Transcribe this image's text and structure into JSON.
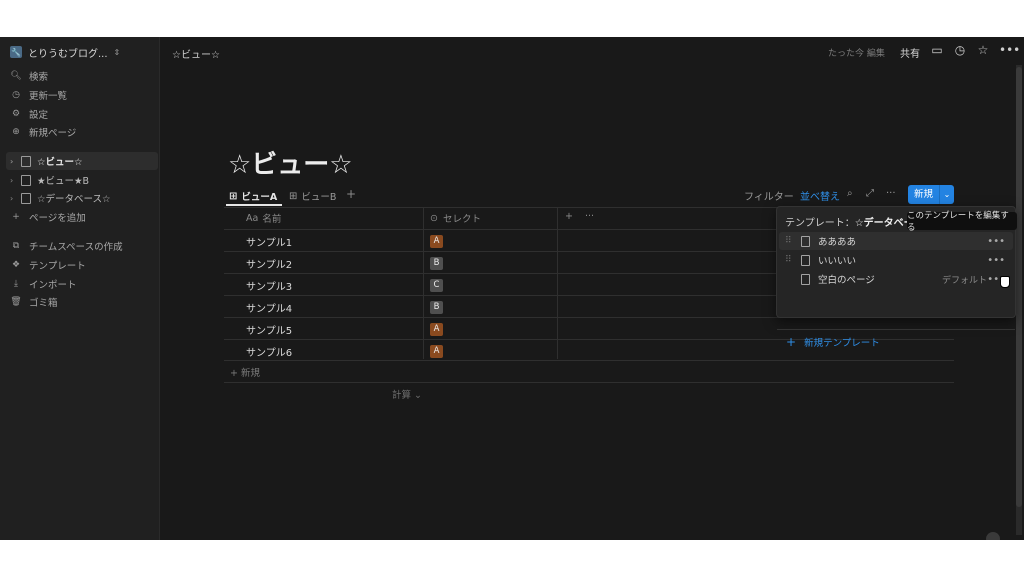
{
  "workspace": {
    "name": "とりうむブログ...",
    "logo": "🔧"
  },
  "sidebar": {
    "nav": [
      {
        "label": "検索",
        "icon": "search-icon"
      },
      {
        "label": "更新一覧",
        "icon": "clock-icon"
      },
      {
        "label": "設定",
        "icon": "gear-icon"
      },
      {
        "label": "新規ページ",
        "icon": "plus-circle-icon"
      }
    ],
    "pages": [
      {
        "label": "☆ビュー☆"
      },
      {
        "label": "★ビュー★B"
      },
      {
        "label": "☆データベース☆"
      }
    ],
    "add_page": "ページを追加",
    "bottom": [
      {
        "label": "チームスペースの作成"
      },
      {
        "label": "テンプレート"
      },
      {
        "label": "インポート"
      },
      {
        "label": "ゴミ箱"
      }
    ]
  },
  "topbar": {
    "breadcrumb": "☆ビュー☆",
    "edited": "たった今 編集",
    "share": "共有"
  },
  "page": {
    "title": "☆ビュー☆"
  },
  "views": {
    "tabs": [
      {
        "label": "ビューA"
      },
      {
        "label": "ビューB"
      }
    ],
    "filter": "フィルター",
    "sort": "並べ替え",
    "new_button": "新規"
  },
  "table": {
    "col_name_prefix": "Aa",
    "col_name": "名前",
    "col_select": "セレクト",
    "rows": [
      {
        "name": "サンプル1",
        "tag": "A"
      },
      {
        "name": "サンプル2",
        "tag": "B"
      },
      {
        "name": "サンプル3",
        "tag": "C"
      },
      {
        "name": "サンプル4",
        "tag": "B"
      },
      {
        "name": "サンプル5",
        "tag": "A"
      },
      {
        "name": "サンプル6",
        "tag": "A"
      }
    ],
    "add_row": "新規",
    "calc": "計算"
  },
  "template_menu": {
    "title_prefix": "テンプレート：",
    "title_db": "☆データベー",
    "tooltip": "このテンプレートを編集する",
    "items": [
      {
        "label": "ああああ"
      },
      {
        "label": "いいいい"
      },
      {
        "label": "空白のページ",
        "badge": "デフォルト"
      }
    ],
    "new_template": "新規テンプレート"
  },
  "colors": {
    "accent": "#2383e2",
    "tag_orange": "#8a4a1f",
    "tag_gray": "#4f4f4f",
    "bg": "#191919"
  }
}
